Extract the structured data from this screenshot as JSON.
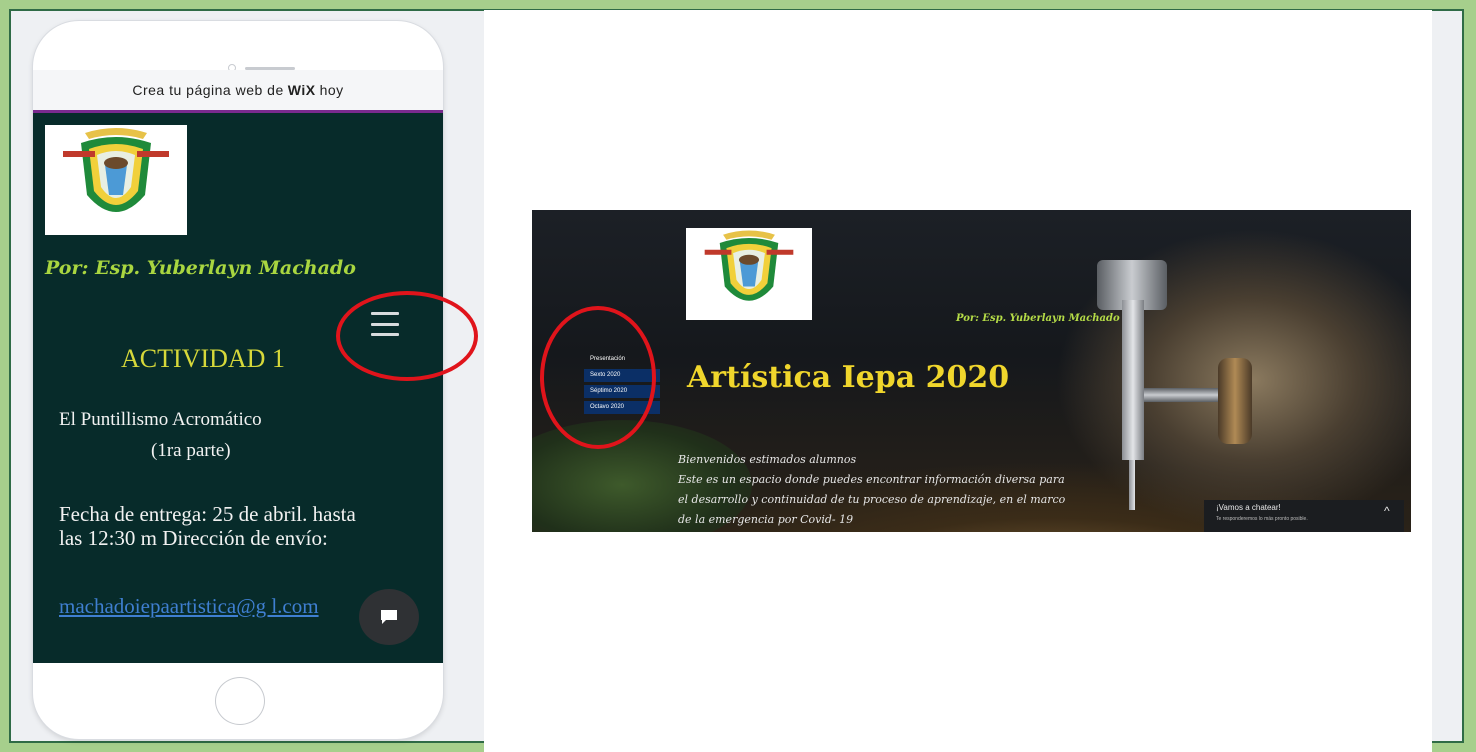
{
  "phone": {
    "wix_banner": {
      "prefix": "Crea tu página web de",
      "brand": "WiX",
      "suffix": "hoy"
    },
    "author": "Por: Esp. Yuberlayn Machado",
    "activity_title": "ACTIVIDAD 1",
    "activity_subtitle_line1": "El Puntillismo Acromático",
    "activity_subtitle_line2": "(1ra parte)",
    "body_text": "Fecha de entrega: 25 de abril.  hasta las 12:30 m Dirección de envío:",
    "email_link": "machadoiepaartistica@g l.com",
    "icons": {
      "menu": "hamburger-menu-icon",
      "chat": "chat-bubble-icon"
    }
  },
  "desktop": {
    "author": "Por: Esp. Yuberlayn Machado",
    "menu_items": [
      "Presentación",
      "Sexto 2020",
      "Séptimo 2020",
      "Octavo 2020"
    ],
    "title": "Artística Iepa  2020",
    "welcome_line1": "Bienvenidos estimados alumnos",
    "welcome_line2": "Este es un espacio donde puedes encontrar  información  diversa para",
    "welcome_line3": "el desarrollo y continuidad  de tu proceso de aprendizaje, en el marco",
    "welcome_line4": "de la emergencia por Covid- 19",
    "chat_title": "¡Vamos a chatear!",
    "chat_subtitle": "Te responderemos lo más pronto posible.",
    "chat_caret": "^"
  },
  "colors": {
    "background": "#a6cf8c",
    "annotation": "#e0141b",
    "site_dark": "#072b2a",
    "title_yellow": "#f0d62c",
    "author_green": "#a9d640"
  }
}
